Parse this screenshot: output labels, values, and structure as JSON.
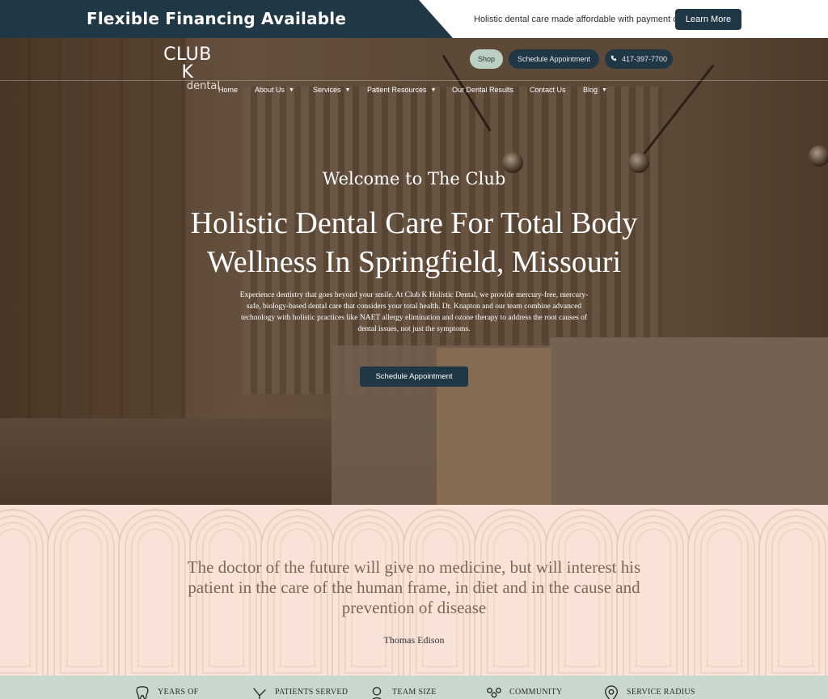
{
  "banner": {
    "title": "Flexible Financing Available",
    "tagline": "Holistic dental care made affordable with payment options",
    "button": "Learn More"
  },
  "header": {
    "logo_main": "CLUB K",
    "logo_sub": "dental",
    "shop": "Shop",
    "schedule": "Schedule Appointment",
    "phone": "417-397-7700",
    "nav": [
      {
        "label": "Home",
        "has_caret": false
      },
      {
        "label": "About Us",
        "has_caret": true
      },
      {
        "label": "Services",
        "has_caret": true
      },
      {
        "label": "Patient Resources",
        "has_caret": true
      },
      {
        "label": "Our Dental Results",
        "has_caret": false
      },
      {
        "label": "Contact Us",
        "has_caret": false
      },
      {
        "label": "Blog",
        "has_caret": true
      }
    ]
  },
  "hero": {
    "eyebrow": "Welcome to The Club",
    "title": "Holistic Dental Care For Total Body Wellness In Springfield, Missouri",
    "description": "Experience dentistry that goes beyond your smile. At Club K Holistic Dental, we provide mercury-free, mercury-safe, biology-based dental care that considers your total health. Dr. Knapton and our team combine advanced technology with holistic practices like NAET allergy elimination and ozone therapy to address the root causes of dental issues, not just the symptoms.",
    "button": "Schedule Appointment"
  },
  "quote": {
    "text": "The doctor of the future will give no medicine, but will interest his patient in the care of the human frame, in diet and in the cause and prevention of disease",
    "author": "Thomas Edison"
  },
  "stats": [
    {
      "label": "YEARS OF",
      "icon": "tooth-icon"
    },
    {
      "label": "PATIENTS SERVED",
      "icon": "dental-tool-icon"
    },
    {
      "label": "TEAM SIZE",
      "icon": "person-icon"
    },
    {
      "label": "COMMUNITY",
      "icon": "community-icon"
    },
    {
      "label": "SERVICE RADIUS",
      "icon": "location-icon"
    }
  ],
  "colors": {
    "navy": "#203746",
    "blush": "#f9e3d8",
    "sage": "#c9d8cd",
    "quote_text": "#7c6758"
  }
}
